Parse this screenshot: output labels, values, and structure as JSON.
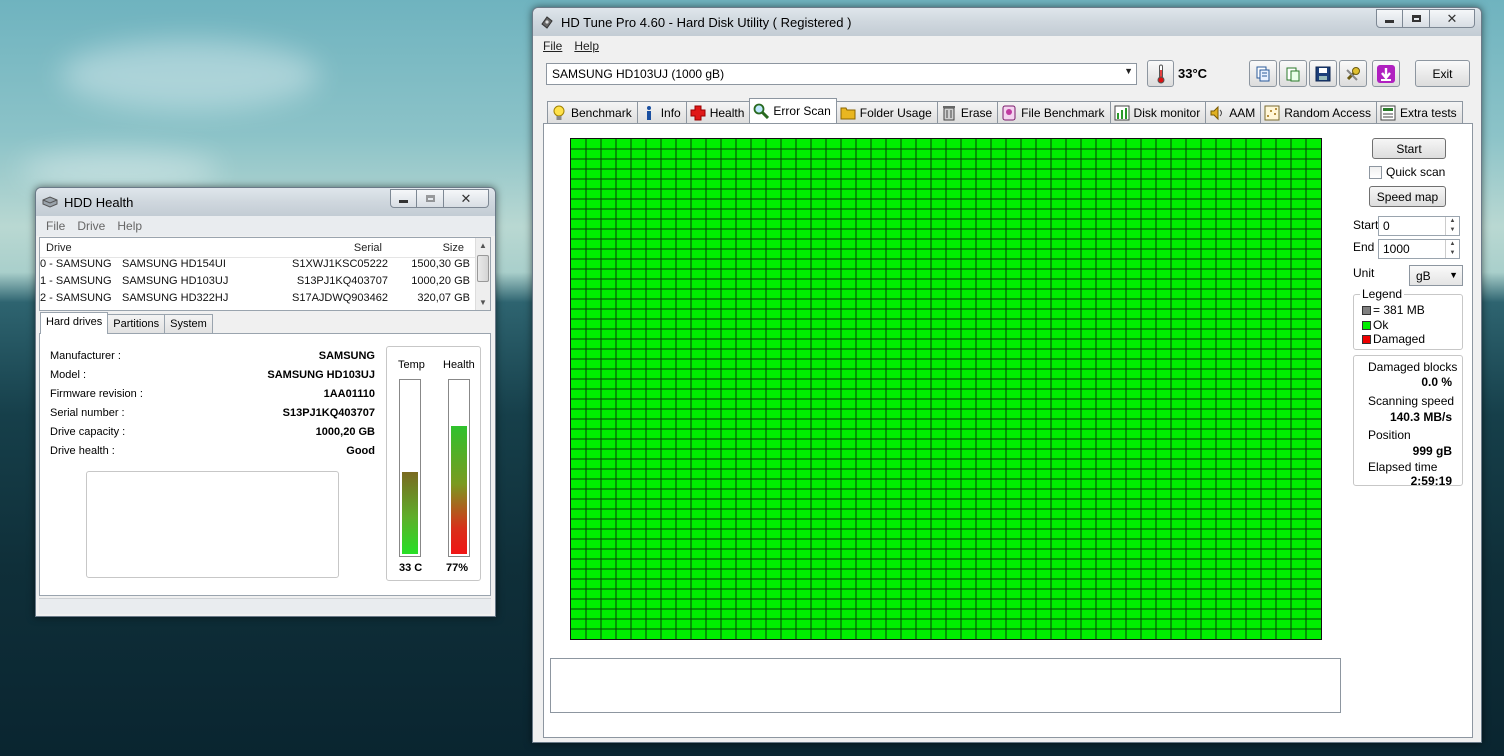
{
  "hdd_health": {
    "title": "HDD Health",
    "menu": [
      "File",
      "Drive",
      "Help"
    ],
    "columns": {
      "drive": "Drive",
      "serial": "Serial",
      "size": "Size"
    },
    "drives": [
      {
        "id": "0 - SAMSUNG",
        "model": "SAMSUNG HD154UI",
        "serial": "S1XWJ1KSC05222",
        "size": "1500,30 GB"
      },
      {
        "id": "1 - SAMSUNG",
        "model": "SAMSUNG HD103UJ",
        "serial": "S13PJ1KQ403707",
        "size": "1000,20 GB"
      },
      {
        "id": "2 - SAMSUNG",
        "model": "SAMSUNG HD322HJ",
        "serial": "S17AJDWQ903462",
        "size": "320,07 GB"
      }
    ],
    "tabs": [
      "Hard drives",
      "Partitions",
      "System"
    ],
    "details": [
      {
        "label": "Manufacturer :",
        "value": "SAMSUNG"
      },
      {
        "label": "Model :",
        "value": "SAMSUNG HD103UJ"
      },
      {
        "label": "Firmware revision :",
        "value": "1AA01110"
      },
      {
        "label": "Serial number :",
        "value": "S13PJ1KQ403707"
      },
      {
        "label": "Drive capacity :",
        "value": "1000,20 GB"
      },
      {
        "label": "Drive health :",
        "value": "Good"
      }
    ],
    "gauges": {
      "temp_label": "Temp",
      "temp_value": "33 C",
      "temp_level": 0.49,
      "health_label": "Health",
      "health_value": "77%",
      "health_level": 0.75
    }
  },
  "hdtune": {
    "title": "HD Tune Pro 4.60 - Hard Disk Utility (  Registered )",
    "menu": [
      "File",
      "Help"
    ],
    "drive_select": "SAMSUNG HD103UJ (1000 gB)",
    "temperature": "33°C",
    "exit_label": "Exit",
    "tabs": [
      {
        "label": "Benchmark",
        "icon": "bulb-icon"
      },
      {
        "label": "Info",
        "icon": "info-icon"
      },
      {
        "label": "Health",
        "icon": "health-cross-icon"
      },
      {
        "label": "Error Scan",
        "icon": "magnifier-icon"
      },
      {
        "label": "Folder Usage",
        "icon": "folder-icon"
      },
      {
        "label": "Erase",
        "icon": "trash-icon"
      },
      {
        "label": "File Benchmark",
        "icon": "file-benchmark-icon"
      },
      {
        "label": "Disk monitor",
        "icon": "disk-monitor-icon"
      },
      {
        "label": "AAM",
        "icon": "speaker-icon"
      },
      {
        "label": "Random Access",
        "icon": "random-access-icon"
      },
      {
        "label": "Extra tests",
        "icon": "extra-tests-icon"
      }
    ],
    "active_tab": "Error Scan",
    "scan": {
      "start_button": "Start",
      "quick_scan_label": "Quick scan",
      "quick_scan_checked": false,
      "speed_map_button": "Speed map",
      "start_label": "Start",
      "start_value": "0",
      "end_label": "End",
      "end_value": "1000",
      "unit_label": "Unit",
      "unit_value": "gB",
      "legend_title": "Legend",
      "legend": [
        {
          "label": "= 381 MB",
          "color": "#808080"
        },
        {
          "label": "Ok",
          "color": "#00ee00"
        },
        {
          "label": "Damaged",
          "color": "#ee0000"
        }
      ],
      "stats": {
        "damaged_label": "Damaged blocks",
        "damaged_value": "0.0 %",
        "speed_label": "Scanning speed",
        "speed_value": "140.3 MB/s",
        "position_label": "Position",
        "position_value": "999 gB",
        "elapsed_label": "Elapsed time",
        "elapsed_value": "2:59:19"
      },
      "grid": {
        "columns": 50,
        "rows": 50,
        "ok_color": "#00ee00",
        "line_color": "#0a3a0a"
      }
    }
  }
}
